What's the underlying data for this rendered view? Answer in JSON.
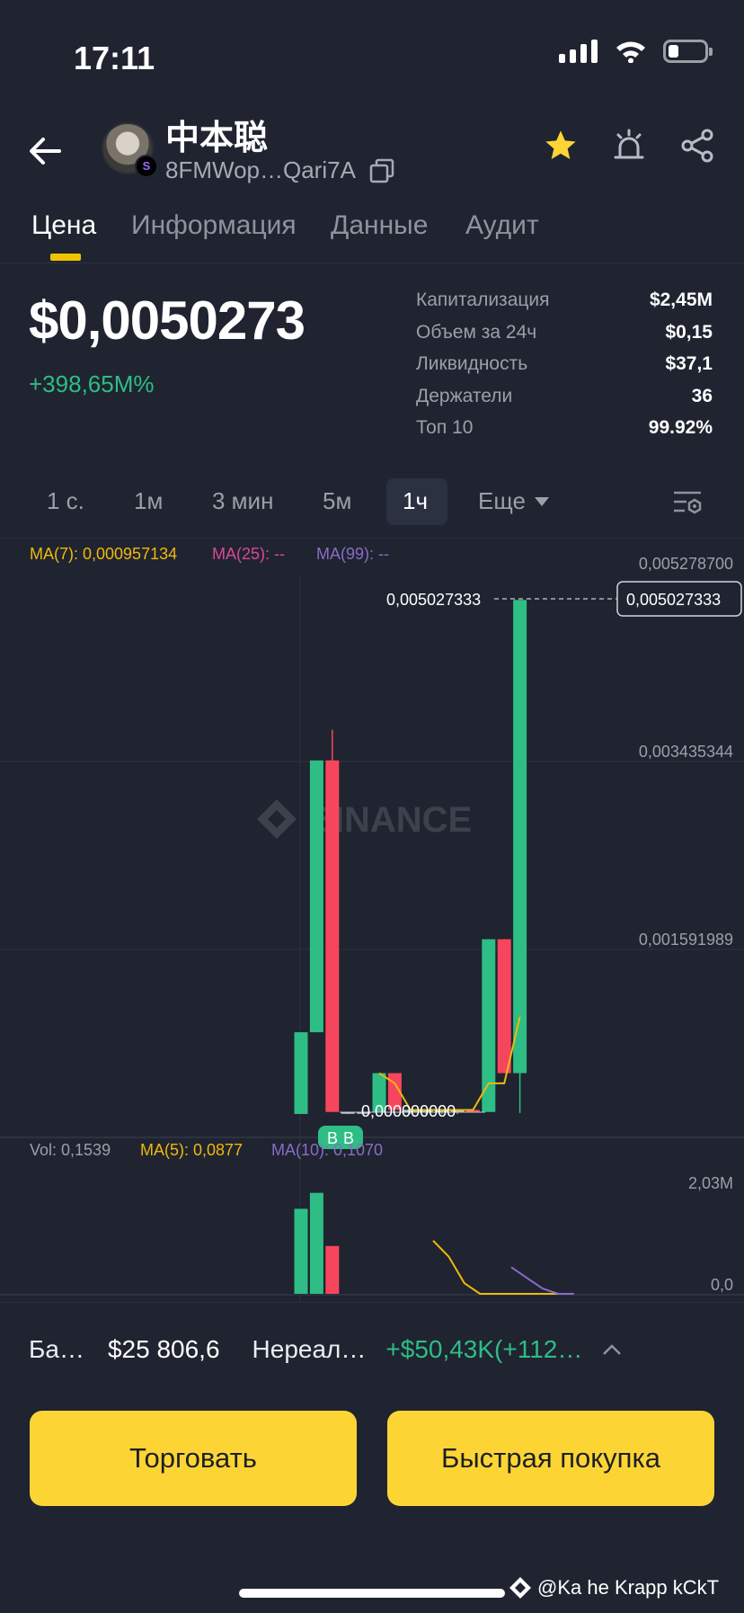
{
  "status": {
    "time": "17:11",
    "battery_level": 0.3
  },
  "header": {
    "token_name": "中本聪",
    "address": "8FMWop…Qari7A",
    "chain_badge": "S"
  },
  "tabs": [
    "Цена",
    "Информация",
    "Данные",
    "Аудит"
  ],
  "price": {
    "value": "$0,0050273",
    "change": "+398,65M%"
  },
  "stats": [
    {
      "label": "Капитализация",
      "value": "$2,45M"
    },
    {
      "label": "Объем за 24ч",
      "value": "$0,15"
    },
    {
      "label": "Ликвидность",
      "value": "$37,1"
    },
    {
      "label": "Держатели",
      "value": "36"
    },
    {
      "label": "Топ 10",
      "value": "99.92%"
    }
  ],
  "intervals": [
    "1 с.",
    "1м",
    "3 мин",
    "5м",
    "1ч",
    "Еще"
  ],
  "chart": {
    "ma7": "MA(7): 0,000957134",
    "ma25": "MA(25): --",
    "ma99": "MA(99): --",
    "axis_labels": [
      "0,005278700",
      "0,003435344",
      "0,001591989"
    ],
    "last_price_label": "0,005027333",
    "last_price_tag": "0,005027333",
    "low_label": "0,000000000",
    "watermark": "BINANCE",
    "marker_b1": "B",
    "marker_b2": "B",
    "vol_label": "Vol: 0,1539",
    "vol_ma5": "MA(5): 0,0877",
    "vol_ma10": "MA(10): 0,1070",
    "vol_max": "2,03M",
    "vol_min": "0,0"
  },
  "chart_data": {
    "type": "candlestick",
    "ylim": [
      0,
      0.0052787
    ],
    "candles": [
      {
        "open": 1e-07,
        "close": 0.0008,
        "high": 0.0008,
        "low": 1e-07,
        "dir": "up"
      },
      {
        "open": 0.0008,
        "close": 0.00346,
        "high": 0.00346,
        "low": 0.0008,
        "dir": "up"
      },
      {
        "open": 0.00346,
        "close": 2e-05,
        "high": 0.00376,
        "low": 2e-05,
        "dir": "down"
      },
      {
        "open": 2e-05,
        "close": 2e-05,
        "high": 2e-05,
        "low": 0.0,
        "dir": "flat"
      },
      {
        "open": 2e-05,
        "close": 2e-05,
        "high": 2e-05,
        "low": 0.0,
        "dir": "flat"
      },
      {
        "open": 2e-05,
        "close": 0.0004,
        "high": 0.0004,
        "low": 2e-05,
        "dir": "up"
      },
      {
        "open": 0.0004,
        "close": 4e-05,
        "high": 0.0004,
        "low": 4e-05,
        "dir": "down"
      },
      {
        "open": 4e-05,
        "close": 4e-05,
        "high": 4e-05,
        "low": 0.0,
        "dir": "flat"
      },
      {
        "open": 4e-05,
        "close": 4e-05,
        "high": 4e-05,
        "low": 0.0,
        "dir": "flat"
      },
      {
        "open": 4e-05,
        "close": 4e-05,
        "high": 4e-05,
        "low": 0.0,
        "dir": "flat"
      },
      {
        "open": 4e-05,
        "close": 4e-05,
        "high": 4e-05,
        "low": 0.0,
        "dir": "flat"
      },
      {
        "open": 4e-05,
        "close": 2e-05,
        "high": 4e-05,
        "low": 2e-05,
        "dir": "down"
      },
      {
        "open": 2e-05,
        "close": 0.00171,
        "high": 0.00171,
        "low": 2e-05,
        "dir": "up"
      },
      {
        "open": 0.00171,
        "close": 0.0004,
        "high": 0.00171,
        "low": 0.0004,
        "dir": "down"
      },
      {
        "open": 0.0004,
        "close": 0.00503,
        "high": 0.00503,
        "low": 1e-05,
        "dir": "up"
      }
    ],
    "ma7_line": [
      null,
      null,
      null,
      null,
      null,
      0.0004,
      0.0003,
      4e-05,
      4e-05,
      4e-05,
      4e-05,
      4e-05,
      0.0003,
      0.0003,
      0.00095
    ],
    "volumes": [
      1.6,
      1.9,
      0.9,
      0,
      0,
      0,
      0,
      0,
      0,
      0,
      0,
      0,
      0,
      0,
      0
    ],
    "vol_ma5": [
      null,
      null,
      null,
      null,
      null,
      1.0,
      0.7,
      0.2,
      0,
      0,
      0,
      0,
      0,
      0,
      0
    ],
    "vol_ma10": [
      null,
      null,
      null,
      null,
      null,
      null,
      null,
      null,
      null,
      null,
      0.5,
      0.3,
      0.1,
      0,
      0
    ],
    "vol_ylim": [
      0,
      2.03
    ]
  },
  "bottom": {
    "balance_label": "Ба…",
    "balance_value": "$25 806,6",
    "unrealized_label": "Нереал…",
    "unrealized_value": "+$50,43K(+112…",
    "trade_button": "Торговать",
    "quick_buy_button": "Быстрая покупка",
    "watermark_text": "@Ka he Krapp kCkT"
  },
  "colors": {
    "up": "#2ebd85",
    "down": "#f6465d",
    "accent": "#fcd535",
    "ma7": "#f0b90b",
    "ma25": "#d9489c",
    "ma99": "#8a6cc7"
  }
}
